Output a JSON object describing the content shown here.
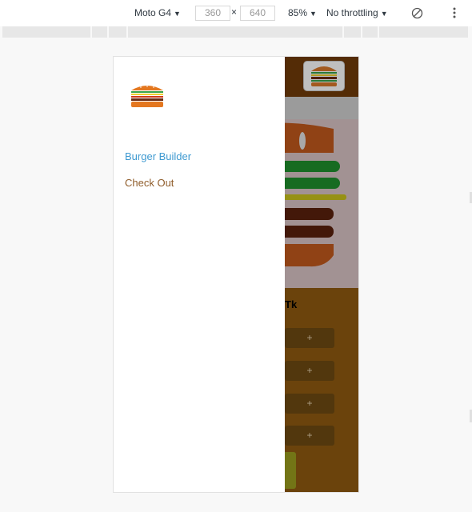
{
  "devtools": {
    "device": "Moto G4",
    "width": "360",
    "times": "×",
    "height": "640",
    "zoom": "85%",
    "throttling": "No throttling",
    "caret": "▼",
    "rotate_icon": "rotate-icon",
    "more_icon": "kebab-icon"
  },
  "drawer": {
    "logo_icon": "burger-logo",
    "links": [
      {
        "label": "Burger Builder",
        "active": true
      },
      {
        "label": "Check Out",
        "active": false
      }
    ]
  },
  "app": {
    "price_fragment": "Tk",
    "control_plus": "+",
    "colors": {
      "header": "#703b09",
      "controls": "#8f5a10",
      "active_link": "#3f9ad1",
      "link": "#8f5c2a"
    }
  }
}
